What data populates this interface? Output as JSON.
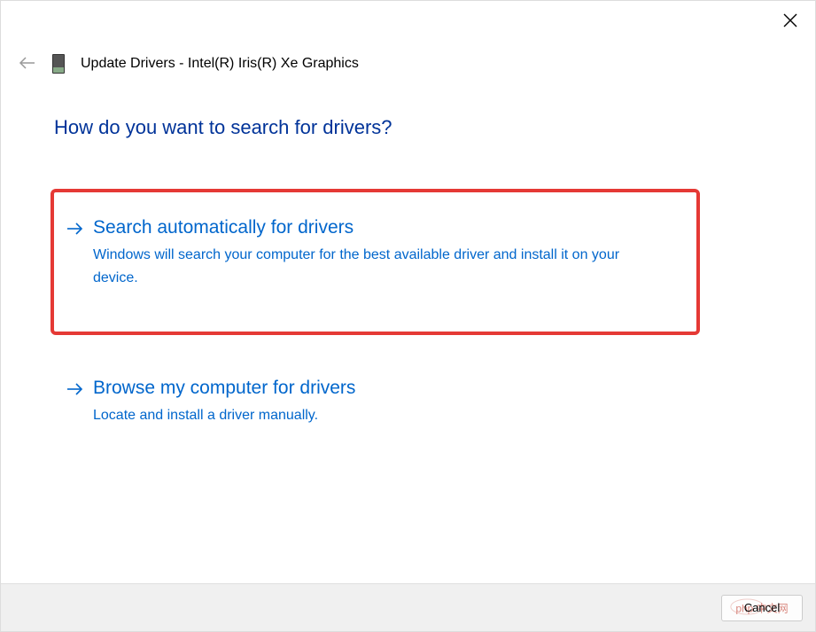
{
  "header": {
    "title": "Update Drivers - Intel(R) Iris(R) Xe Graphics"
  },
  "question": "How do you want to search for drivers?",
  "options": [
    {
      "title": "Search automatically for drivers",
      "description": "Windows will search your computer for the best available driver and install it on your device."
    },
    {
      "title": "Browse my computer for drivers",
      "description": "Locate and install a driver manually."
    }
  ],
  "footer": {
    "cancel_label": "Cancel"
  },
  "watermark": "php 中文网"
}
